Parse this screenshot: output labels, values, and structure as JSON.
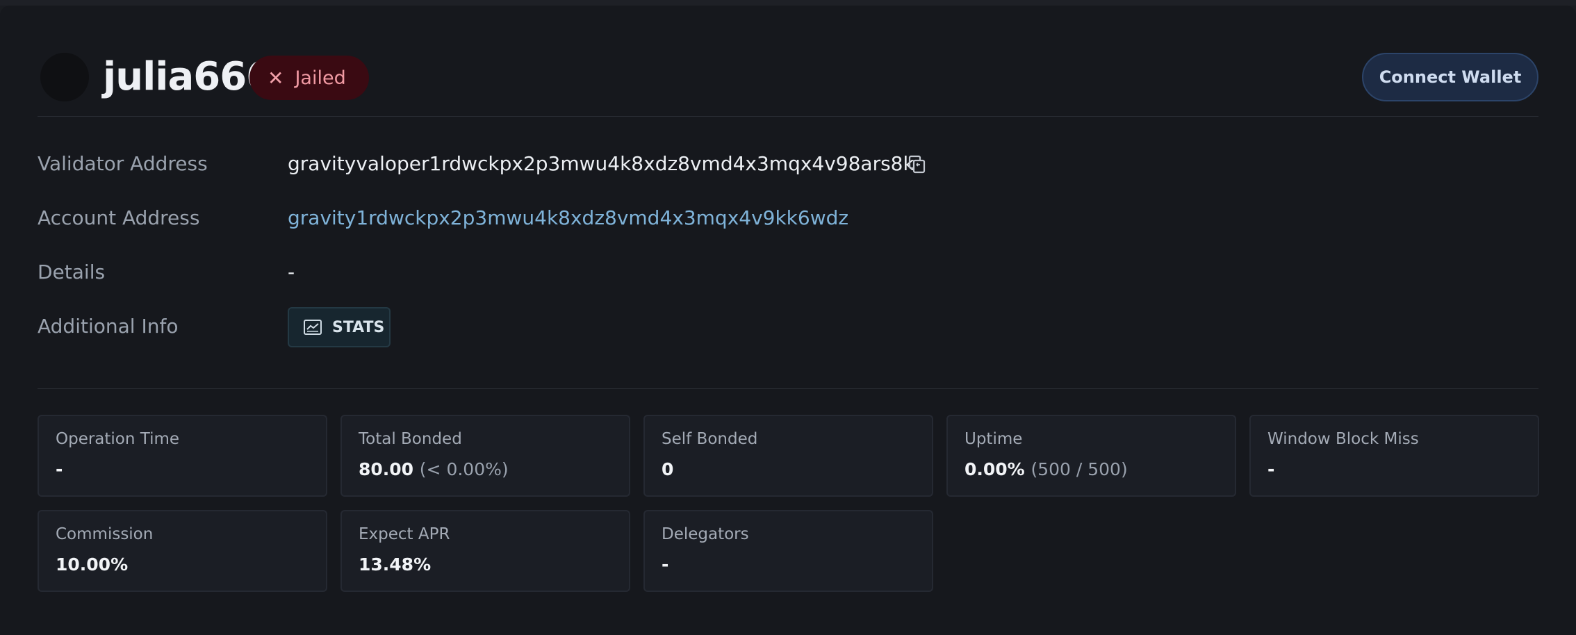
{
  "validator": {
    "name": "julia666",
    "status_label": "Jailed",
    "status_icon": "close-icon"
  },
  "header": {
    "connect_label": "Connect Wallet"
  },
  "info": {
    "validator_address_label": "Validator Address",
    "validator_address": "gravityvaloper1rdwckpx2p3mwu4k8xdz8vmd4x3mqx4v98ars8k",
    "account_address_label": "Account Address",
    "account_address": "gravity1rdwckpx2p3mwu4k8xdz8vmd4x3mqx4v9kk6wdz",
    "details_label": "Details",
    "details": "-",
    "additional_info_label": "Additional Info",
    "stats_label": "STATS"
  },
  "stats": {
    "operation_time": {
      "label": "Operation Time",
      "value": "-"
    },
    "total_bonded": {
      "label": "Total Bonded",
      "value": "80.00",
      "sub": "(< 0.00%)"
    },
    "self_bonded": {
      "label": "Self Bonded",
      "value": "0"
    },
    "uptime": {
      "label": "Uptime",
      "value": "0.00%",
      "sub": "(500 / 500)"
    },
    "window_block_miss": {
      "label": "Window Block Miss",
      "value": "-"
    },
    "commission": {
      "label": "Commission",
      "value": "10.00%"
    },
    "expect_apr": {
      "label": "Expect APR",
      "value": "13.48%"
    },
    "delegators": {
      "label": "Delegators",
      "value": "-"
    }
  },
  "colors": {
    "background": "#16181d",
    "jailed_badge_bg": "#3a0a12",
    "jailed_badge_text": "#f19aa3",
    "link": "#7fb3d9",
    "connect_button_bg": "#1d2b44"
  }
}
